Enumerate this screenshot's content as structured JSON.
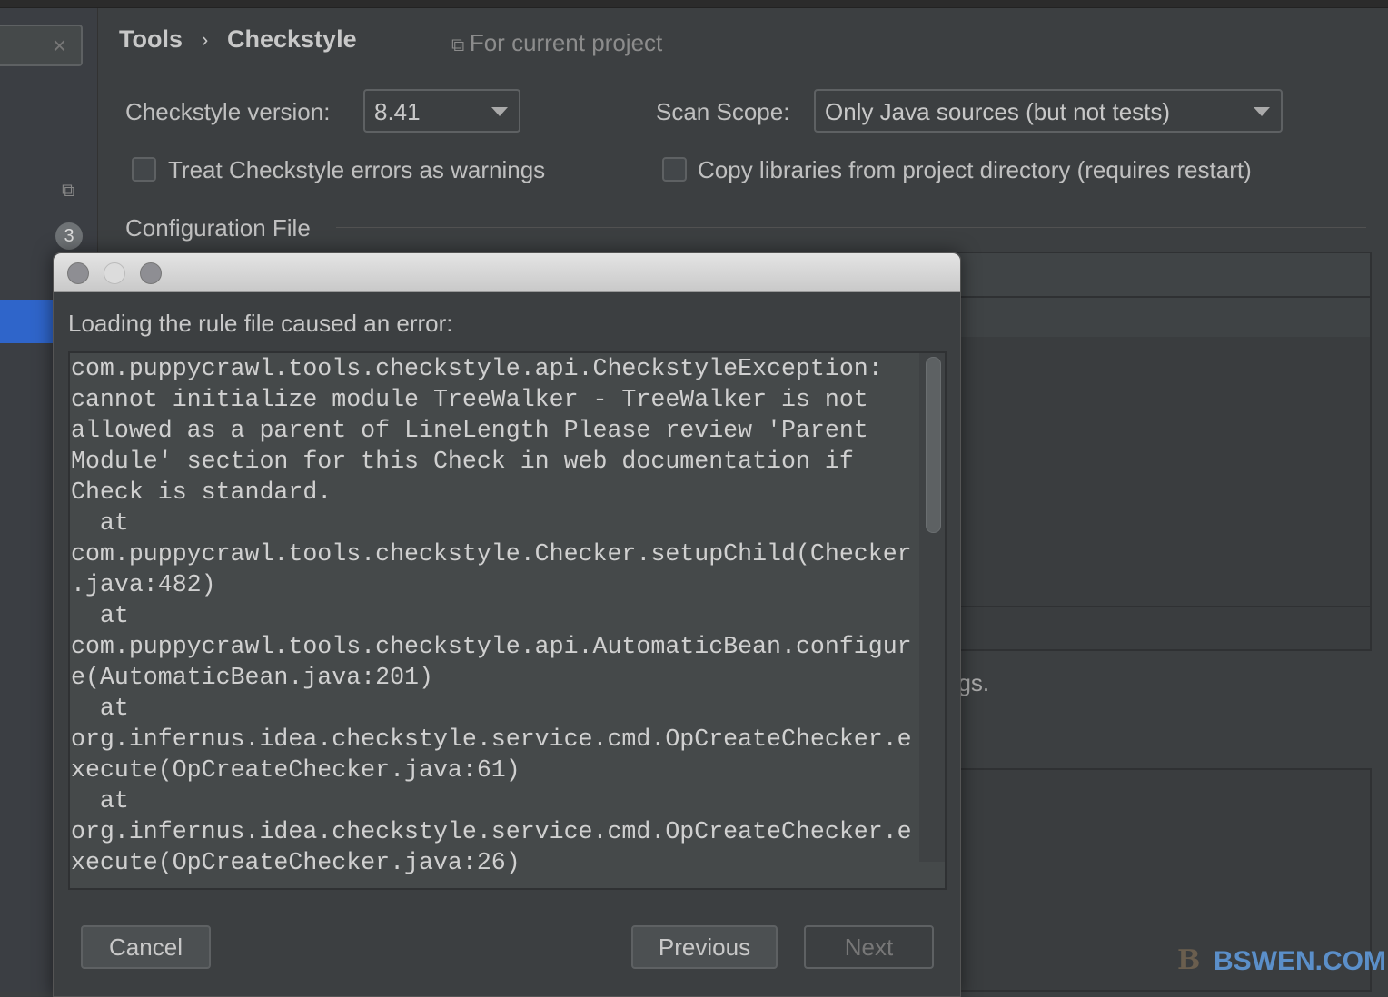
{
  "breadcrumb": {
    "parent": "Tools",
    "separator": "›",
    "current": "Checkstyle"
  },
  "scope_hint": "For current project",
  "sidebar": {
    "badge": "3",
    "clear": "×"
  },
  "settings": {
    "version_label": "Checkstyle version:",
    "version_value": "8.41",
    "scan_label": "Scan Scope:",
    "scan_value": "Only Java sources (but not tests)",
    "treat_errors": "Treat Checkstyle errors as warnings",
    "treat_errors_checked": false,
    "copy_libs": "Copy libraries from project directory (requires restart)",
    "copy_libs_checked": false,
    "config_file": "Configuration File",
    "partial_text": "ngs."
  },
  "dialog": {
    "message": "Loading the rule file caused an error:",
    "error_text": "com.puppycrawl.tools.checkstyle.api.CheckstyleException:\ncannot initialize module TreeWalker - TreeWalker is not\nallowed as a parent of LineLength Please review 'Parent\nModule' section for this Check in web documentation if\nCheck is standard.\n  at\ncom.puppycrawl.tools.checkstyle.Checker.setupChild(Checker\n.java:482)\n  at\ncom.puppycrawl.tools.checkstyle.api.AutomaticBean.configur\ne(AutomaticBean.java:201)\n  at\norg.infernus.idea.checkstyle.service.cmd.OpCreateChecker.e\nxecute(OpCreateChecker.java:61)\n  at\norg.infernus.idea.checkstyle.service.cmd.OpCreateChecker.e\nxecute(OpCreateChecker.java:26)",
    "cancel": "Cancel",
    "previous": "Previous",
    "next": "Next"
  },
  "watermark": "BSWEN.COM",
  "colors": {
    "background": "#3c3f41",
    "selection": "#2f65ca",
    "watermark": "#5b8fc9"
  }
}
